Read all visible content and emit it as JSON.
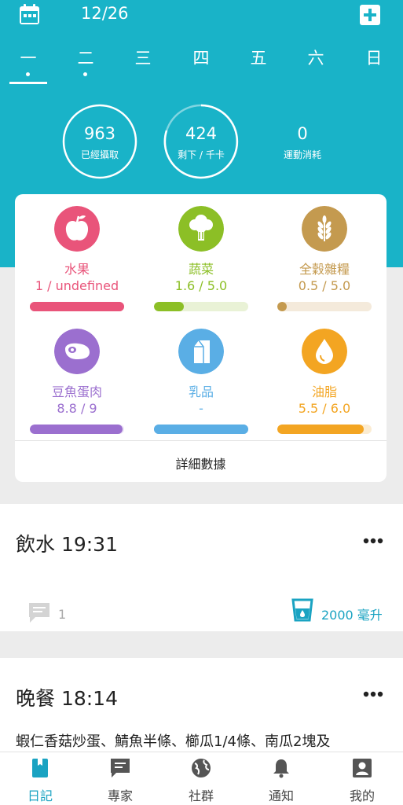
{
  "header": {
    "date": "12/26"
  },
  "weekdays": [
    {
      "label": "一",
      "dot": true,
      "active": true
    },
    {
      "label": "二",
      "dot": true,
      "active": false
    },
    {
      "label": "三",
      "dot": false,
      "active": false
    },
    {
      "label": "四",
      "dot": false,
      "active": false
    },
    {
      "label": "五",
      "dot": false,
      "active": false
    },
    {
      "label": "六",
      "dot": false,
      "active": false
    },
    {
      "label": "日",
      "dot": false,
      "active": false
    }
  ],
  "stats": [
    {
      "value": "963",
      "label": "已經攝取",
      "ring": true
    },
    {
      "value": "424",
      "label": "剩下 / 千卡",
      "ring": true
    },
    {
      "value": "0",
      "label": "運動消耗",
      "ring": false
    }
  ],
  "food_groups": [
    {
      "name": "水果",
      "value": "1 / undefined",
      "color": "#e9547a",
      "track": "#e9547a",
      "progress": 1.0,
      "icon": "apple-icon"
    },
    {
      "name": "蔬菜",
      "value": "1.6 / 5.0",
      "color": "#8cbf26",
      "track": "#e9f2d6",
      "progress": 0.32,
      "icon": "broccoli-icon"
    },
    {
      "name": "全穀雜糧",
      "value": "0.5 / 5.0",
      "color": "#c49a4f",
      "track": "#f4eadb",
      "progress": 0.1,
      "icon": "wheat-icon"
    },
    {
      "name": "豆魚蛋肉",
      "value": "8.8 / 9",
      "color": "#9b6fcf",
      "track": "#ece4f6",
      "progress": 0.98,
      "icon": "meat-icon"
    },
    {
      "name": "乳品",
      "value": "-",
      "color": "#5aaee5",
      "track": "#5aaee5",
      "progress": 1.0,
      "icon": "milk-icon"
    },
    {
      "name": "油脂",
      "value": "5.5 / 6.0",
      "color": "#f3a522",
      "track": "#fbecd2",
      "progress": 0.92,
      "icon": "oil-drop-icon"
    }
  ],
  "details_label": "詳細數據",
  "entries": {
    "water": {
      "title": "飲水 19:31",
      "comments": "1",
      "amount": "2000 毫升"
    },
    "dinner": {
      "title": "晚餐 18:14",
      "description": "蝦仁香菇炒蛋、鯖魚半條、櫛瓜1/4條、南瓜2塊及"
    }
  },
  "nav": [
    {
      "label": "日記",
      "icon": "diary-icon",
      "active": true
    },
    {
      "label": "專家",
      "icon": "chat-icon",
      "active": false
    },
    {
      "label": "社群",
      "icon": "globe-icon",
      "active": false
    },
    {
      "label": "通知",
      "icon": "bell-icon",
      "active": false
    },
    {
      "label": "我的",
      "icon": "profile-icon",
      "active": false
    }
  ],
  "colors": {
    "brand": "#19b3c8",
    "accent": "#1aa3c2"
  }
}
